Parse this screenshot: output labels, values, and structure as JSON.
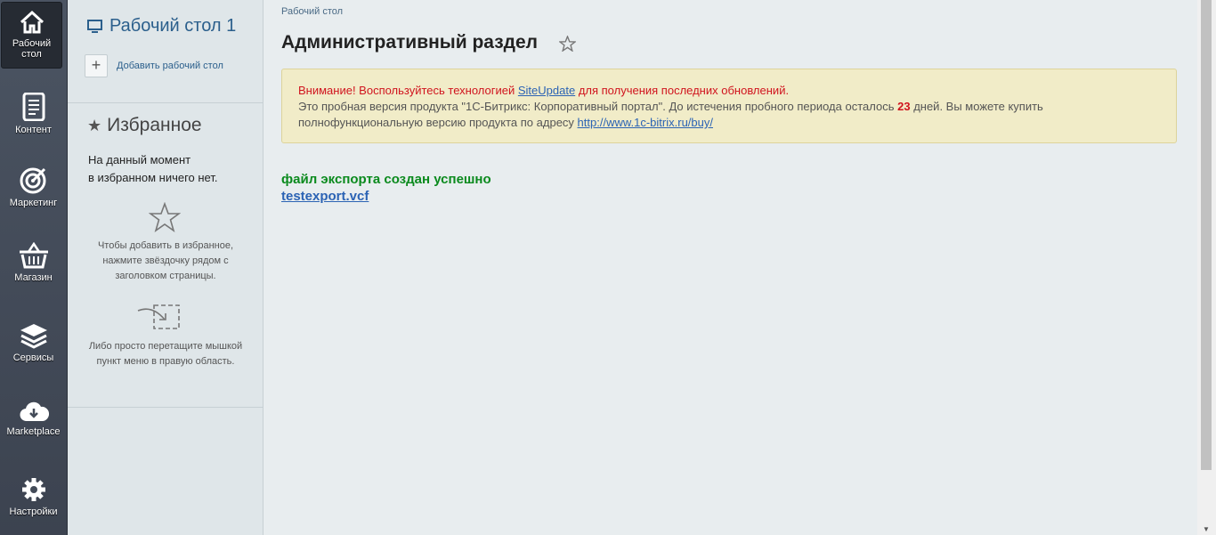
{
  "menu": {
    "items": [
      {
        "label": "Рабочий стол",
        "icon": "home-icon"
      },
      {
        "label": "Контент",
        "icon": "document-icon"
      },
      {
        "label": "Маркетинг",
        "icon": "target-icon"
      },
      {
        "label": "Магазин",
        "icon": "basket-icon"
      },
      {
        "label": "Сервисы",
        "icon": "layers-icon"
      },
      {
        "label": "Marketplace",
        "icon": "cloud-download-icon"
      },
      {
        "label": "Настройки",
        "icon": "gear-icon"
      }
    ]
  },
  "panel": {
    "desktop_title": "Рабочий стол 1",
    "add_desktop": "Добавить рабочий стол",
    "favorites_title": "Избранное",
    "favorites_empty_line1": "На данный момент",
    "favorites_empty_line2": "в избранном ничего нет.",
    "hint_star": "Чтобы добавить в избранное, нажмите звёздочку рядом с заголовком страницы.",
    "hint_drag": "Либо просто перетащите мышкой пункт меню в правую область."
  },
  "main": {
    "breadcrumb": "Рабочий стол",
    "title": "Административный раздел",
    "notice": {
      "warning_prefix": "Внимание! Воспользуйтесь технологией ",
      "warning_link": "SiteUpdate",
      "warning_suffix": " для получения последних обновлений.",
      "trial_prefix": "Это пробная версия продукта \"1С-Битрикс: Корпоративный портал\". До истечения пробного периода осталось ",
      "trial_days": "23",
      "trial_suffix": " дней. Вы можете купить полнофункциональную версию продукта по адресу ",
      "buy_link": "http://www.1c-bitrix.ru/buy/"
    },
    "success_message": "файл экспорта создан успешно",
    "file_link": "testexport.vcf"
  },
  "colors": {
    "menu_bg": "#434b58",
    "link": "#2b63b4",
    "success": "#0a8a1d",
    "warning": "#d0141e",
    "notice_bg": "#f1ecc8"
  }
}
